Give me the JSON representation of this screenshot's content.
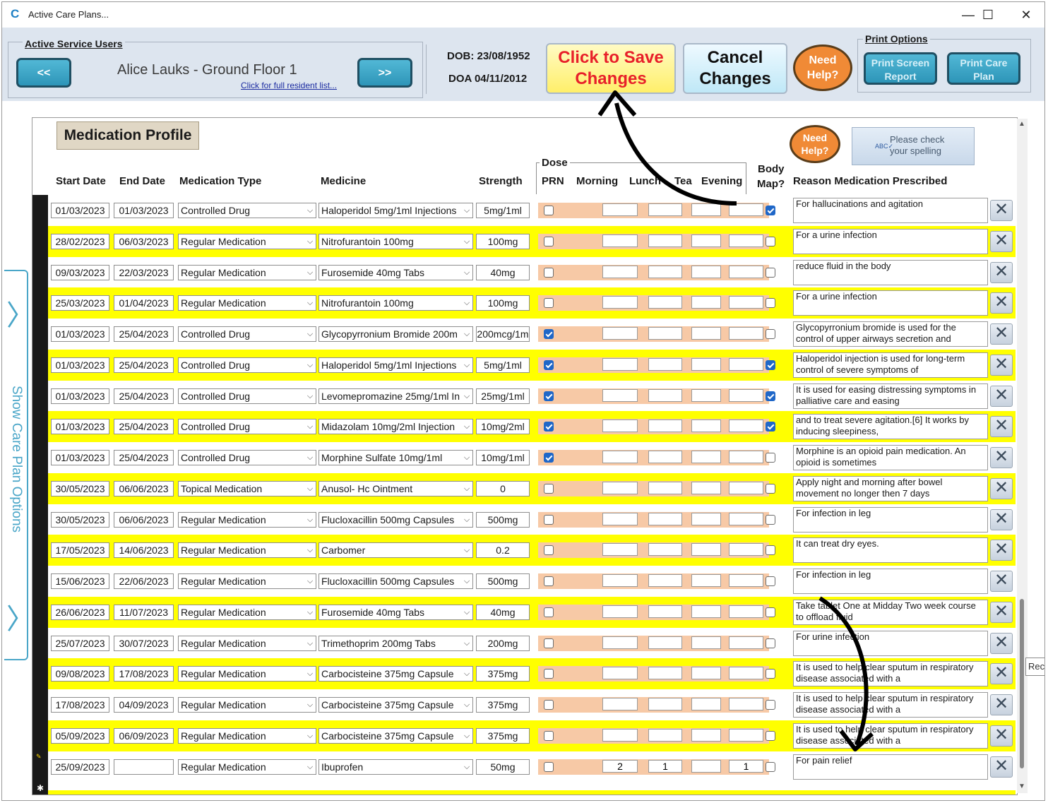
{
  "window": {
    "title": "Active Care Plans...",
    "app_icon": "C",
    "minimize": "—",
    "maximize": "☐",
    "close": "✕"
  },
  "header": {
    "service_users_label": "Active Service Users",
    "prev_label": "<<",
    "next_label": ">>",
    "resident_name": "Alice Lauks - Ground Floor 1",
    "resident_link": "Click for full resident list...",
    "dob": "DOB: 23/08/1952",
    "doa": "DOA 04/11/2012",
    "save_line1": "Click to Save",
    "save_line2": "Changes",
    "cancel_line1": "Cancel",
    "cancel_line2": "Changes",
    "help_line1": "Need",
    "help_line2": "Help?",
    "print_options_label": "Print Options",
    "print_screen_line1": "Print Screen",
    "print_screen_line2": "Report",
    "print_care_line1": "Print Care",
    "print_care_line2": "Plan"
  },
  "sidebar": {
    "label": "Show Care Plan Options",
    "chevron_top": "〉",
    "chevron_bottom": "〉"
  },
  "form": {
    "title": "Medication Profile",
    "help_line1": "Need",
    "help_line2": "Help?",
    "spell_line1": "Please check",
    "spell_line2": "your spelling",
    "spell_icon": "ABC✓",
    "dose_label": "Dose",
    "columns": {
      "start": "Start Date",
      "end": "End Date",
      "type": "Medication Type",
      "medicine": "Medicine",
      "strength": "Strength",
      "prn": "PRN",
      "morning": "Morning",
      "lunch": "Lunch",
      "tea": "Tea",
      "evening": "Evening",
      "body1": "Body",
      "body2": "Map?",
      "reason": "Reason Medication Prescribed"
    },
    "delete_glyph": "✕",
    "new_row_marker": "✱",
    "edit_marker": "✎"
  },
  "rows": [
    {
      "start": "01/03/2023",
      "end": "01/03/2023",
      "type": "Controlled Drug",
      "medicine": "Haloperidol 5mg/1ml Injections",
      "strength": "5mg/1ml",
      "prn": false,
      "morning": "",
      "lunch": "",
      "tea": "",
      "evening": "",
      "body": true,
      "reason": "For hallucinations and agitation"
    },
    {
      "start": "28/02/2023",
      "end": "06/03/2023",
      "type": "Regular Medication",
      "medicine": "Nitrofurantoin 100mg",
      "strength": "100mg",
      "prn": false,
      "morning": "",
      "lunch": "",
      "tea": "",
      "evening": "",
      "body": false,
      "reason": "For a urine infection"
    },
    {
      "start": "09/03/2023",
      "end": "22/03/2023",
      "type": "Regular Medication",
      "medicine": "Furosemide 40mg Tabs",
      "strength": "40mg",
      "prn": false,
      "morning": "",
      "lunch": "",
      "tea": "",
      "evening": "",
      "body": false,
      "reason": "reduce fluid in the body"
    },
    {
      "start": "25/03/2023",
      "end": "01/04/2023",
      "type": "Regular Medication",
      "medicine": "Nitrofurantoin 100mg",
      "strength": "100mg",
      "prn": false,
      "morning": "",
      "lunch": "",
      "tea": "",
      "evening": "",
      "body": false,
      "reason": "For a urine infection"
    },
    {
      "start": "01/03/2023",
      "end": "25/04/2023",
      "type": "Controlled Drug",
      "medicine": "Glycopyrronium Bromide 200m",
      "strength": "200mcg/1m",
      "prn": true,
      "morning": "",
      "lunch": "",
      "tea": "",
      "evening": "",
      "body": false,
      "reason": "Glycopyrronium bromide is used for the control of upper airways secretion and"
    },
    {
      "start": "01/03/2023",
      "end": "25/04/2023",
      "type": "Controlled Drug",
      "medicine": "Haloperidol 5mg/1ml Injections",
      "strength": "5mg/1ml",
      "prn": true,
      "morning": "",
      "lunch": "",
      "tea": "",
      "evening": "",
      "body": true,
      "reason": " Haloperidol injection is used for long-term control of severe symptoms of"
    },
    {
      "start": "01/03/2023",
      "end": "25/04/2023",
      "type": "Controlled Drug",
      "medicine": "Levomepromazine 25mg/1ml In",
      "strength": "25mg/1ml",
      "prn": true,
      "morning": "",
      "lunch": "",
      "tea": "",
      "evening": "",
      "body": true,
      "reason": "It is used for easing distressing symptoms in palliative care and easing"
    },
    {
      "start": "01/03/2023",
      "end": "25/04/2023",
      "type": "Controlled Drug",
      "medicine": "Midazolam 10mg/2ml Injection",
      "strength": "10mg/2ml",
      "prn": true,
      "morning": "",
      "lunch": "",
      "tea": "",
      "evening": "",
      "body": true,
      "reason": " and to treat severe agitation.[6] It works by inducing sleepiness,"
    },
    {
      "start": "01/03/2023",
      "end": "25/04/2023",
      "type": "Controlled Drug",
      "medicine": "Morphine Sulfate 10mg/1ml",
      "strength": "10mg/1ml",
      "prn": true,
      "morning": "",
      "lunch": "",
      "tea": "",
      "evening": "",
      "body": false,
      "reason": "Morphine is an opioid pain medication. An opioid is sometimes"
    },
    {
      "start": "30/05/2023",
      "end": "06/06/2023",
      "type": "Topical Medication",
      "medicine": "Anusol- Hc Ointment",
      "strength": "0",
      "prn": false,
      "morning": "",
      "lunch": "",
      "tea": "",
      "evening": "",
      "body": false,
      "reason": "Apply night and morning after bowel movement no longer then 7 days"
    },
    {
      "start": "30/05/2023",
      "end": "06/06/2023",
      "type": "Regular Medication",
      "medicine": "Flucloxacillin 500mg Capsules",
      "strength": "500mg",
      "prn": false,
      "morning": "",
      "lunch": "",
      "tea": "",
      "evening": "",
      "body": false,
      "reason": "For infection in leg"
    },
    {
      "start": "17/05/2023",
      "end": "14/06/2023",
      "type": "Regular Medication",
      "medicine": "Carbomer",
      "strength": "0.2",
      "prn": false,
      "morning": "",
      "lunch": "",
      "tea": "",
      "evening": "",
      "body": false,
      "reason": "It can treat dry eyes."
    },
    {
      "start": "15/06/2023",
      "end": "22/06/2023",
      "type": "Regular Medication",
      "medicine": "Flucloxacillin 500mg Capsules",
      "strength": "500mg",
      "prn": false,
      "morning": "",
      "lunch": "",
      "tea": "",
      "evening": "",
      "body": false,
      "reason": "For infection in leg"
    },
    {
      "start": "26/06/2023",
      "end": "11/07/2023",
      "type": "Regular Medication",
      "medicine": "Furosemide 40mg Tabs",
      "strength": "40mg",
      "prn": false,
      "morning": "",
      "lunch": "",
      "tea": "",
      "evening": "",
      "body": false,
      "reason": "Take tablet One at Midday Two week course to offload fluid"
    },
    {
      "start": "25/07/2023",
      "end": "30/07/2023",
      "type": "Regular Medication",
      "medicine": "Trimethoprim 200mg Tabs",
      "strength": "200mg",
      "prn": false,
      "morning": "",
      "lunch": "",
      "tea": "",
      "evening": "",
      "body": false,
      "reason": "For urine infection"
    },
    {
      "start": "09/08/2023",
      "end": "17/08/2023",
      "type": "Regular Medication",
      "medicine": "Carbocisteine 375mg Capsule",
      "strength": "375mg",
      "prn": false,
      "morning": "",
      "lunch": "",
      "tea": "",
      "evening": "",
      "body": false,
      "reason": "It is used to help clear sputum in respiratory disease associated with a"
    },
    {
      "start": "17/08/2023",
      "end": "04/09/2023",
      "type": "Regular Medication",
      "medicine": "Carbocisteine 375mg Capsule",
      "strength": "375mg",
      "prn": false,
      "morning": "",
      "lunch": "",
      "tea": "",
      "evening": "",
      "body": false,
      "reason": "It is used to help clear sputum in respiratory disease associated with a"
    },
    {
      "start": "05/09/2023",
      "end": "06/09/2023",
      "type": "Regular Medication",
      "medicine": "Carbocisteine 375mg Capsule",
      "strength": "375mg",
      "prn": false,
      "morning": "",
      "lunch": "",
      "tea": "",
      "evening": "",
      "body": false,
      "reason": "It is used to help clear sputum in respiratory disease associated with a"
    },
    {
      "start": "25/09/2023",
      "end": "",
      "type": "Regular Medication",
      "medicine": "Ibuprofen",
      "strength": "50mg",
      "prn": false,
      "morning": "2",
      "lunch": "1",
      "tea": "",
      "evening": "1",
      "body": false,
      "reason": "For pain relief"
    }
  ],
  "tooltip": "Reco",
  "colors": {
    "header_bg": "#dde5ef",
    "row_highlight": "#ffff00",
    "dose_orange": "#f7c9a6",
    "save_text": "#e8202a",
    "save_bg": "#fff89a",
    "nav_button": "#2d95b8",
    "help_orange": "#f08a36",
    "checkbox_blue": "#1f67c8"
  }
}
